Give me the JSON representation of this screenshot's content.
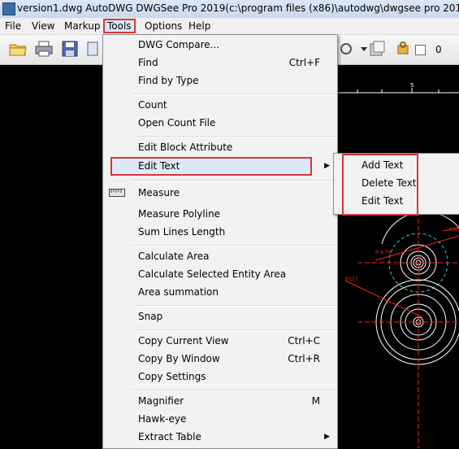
{
  "window": {
    "title": "version1.dwg AutoDWG DWGSee Pro 2019(c:\\program files (x86)\\autodwg\\dwgsee pro 2019)--Networ"
  },
  "menubar": {
    "items": [
      {
        "label": "File"
      },
      {
        "label": "View"
      },
      {
        "label": "Markup"
      },
      {
        "label": "Tools"
      },
      {
        "label": "Options"
      },
      {
        "label": "Help"
      }
    ]
  },
  "toolbar": {
    "field_value": "0"
  },
  "tools_menu": {
    "items": [
      {
        "label": "DWG Compare...",
        "shortcut": ""
      },
      {
        "label": "Find",
        "shortcut": "Ctrl+F"
      },
      {
        "label": "Find  by Type",
        "shortcut": ""
      },
      {
        "label": "Count",
        "shortcut": ""
      },
      {
        "label": "Open Count File",
        "shortcut": ""
      },
      {
        "label": "Edit Block Attribute",
        "shortcut": ""
      },
      {
        "label": "Edit Text",
        "shortcut": "",
        "submenu": true
      },
      {
        "label": "Measure",
        "shortcut": "",
        "icon": "ruler-icon"
      },
      {
        "label": "Measure Polyline",
        "shortcut": ""
      },
      {
        "label": "Sum Lines Length",
        "shortcut": ""
      },
      {
        "label": "Calculate Area",
        "shortcut": ""
      },
      {
        "label": "Calculate Selected Entity Area",
        "shortcut": ""
      },
      {
        "label": "Area summation",
        "shortcut": ""
      },
      {
        "label": "Snap",
        "shortcut": ""
      },
      {
        "label": "Copy Current View",
        "shortcut": "Ctrl+C"
      },
      {
        "label": "Copy By Window",
        "shortcut": "Ctrl+R"
      },
      {
        "label": "Copy Settings",
        "shortcut": ""
      },
      {
        "label": "Magnifier",
        "shortcut": "M"
      },
      {
        "label": "Hawk-eye",
        "shortcut": ""
      },
      {
        "label": "Extract Table",
        "shortcut": "",
        "submenu": true
      }
    ]
  },
  "edit_text_submenu": {
    "items": [
      {
        "label": "Add Text"
      },
      {
        "label": "Delete Text"
      },
      {
        "label": "Edit Text"
      }
    ]
  },
  "drawing": {
    "ruler_label": "5",
    "annotations": [
      "R38",
      "R 6 76",
      "R117"
    ]
  },
  "colors": {
    "highlight_outline": "#d9343c",
    "menu_bg": "#f2f2f2",
    "canvas_bg": "#000000",
    "drawing_lines": "#ffffff",
    "dim_lines": "#ff2020",
    "center_lines": "#2bd3e0"
  }
}
